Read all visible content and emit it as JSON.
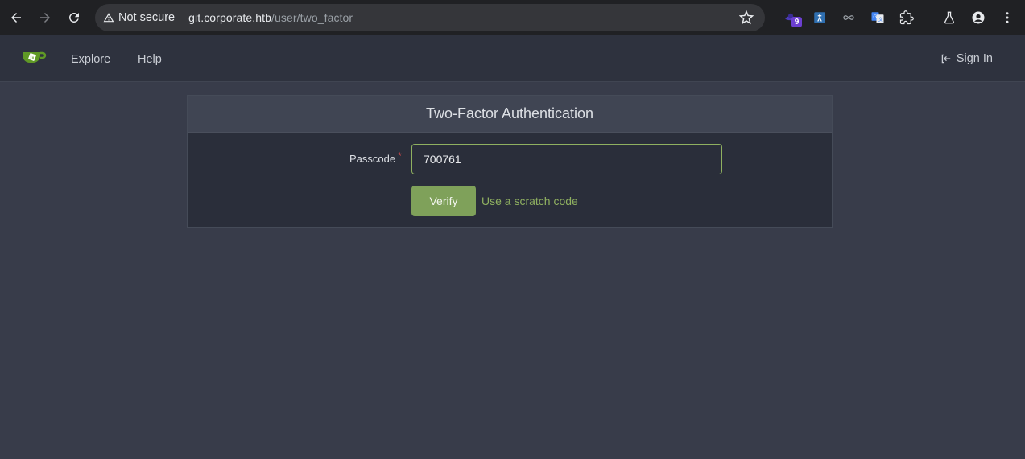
{
  "browser": {
    "security_label": "Not secure",
    "url_host": "git.corporate.htb",
    "url_path": "/user/two_factor",
    "extension_badge": "9"
  },
  "header": {
    "nav": [
      "Explore",
      "Help"
    ],
    "signin_label": "Sign In"
  },
  "card": {
    "title": "Two-Factor Authentication",
    "passcode_label": "Passcode",
    "passcode_value": "700761",
    "verify_label": "Verify",
    "scratch_link": "Use a scratch code"
  },
  "colors": {
    "accent": "#7fa15a",
    "link": "#8fb060",
    "page_bg": "#383c4a",
    "required": "#d94b4b"
  }
}
